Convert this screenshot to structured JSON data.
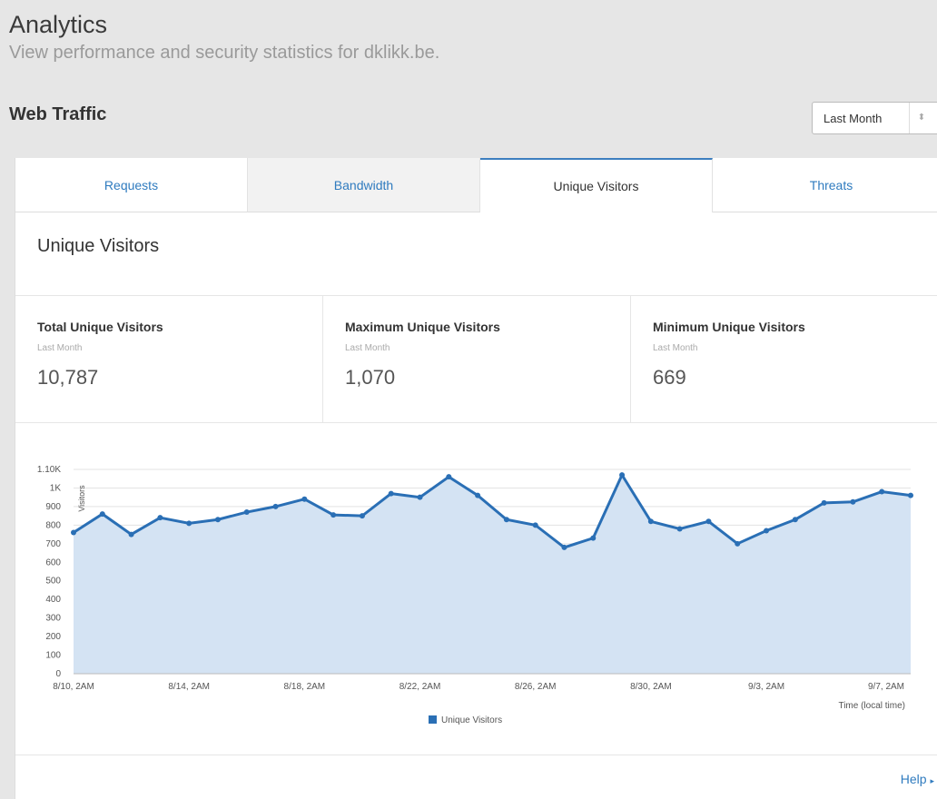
{
  "page": {
    "title": "Analytics",
    "subtitle": "View performance and security statistics for dklikk.be."
  },
  "section": {
    "title": "Web Traffic",
    "period_select": {
      "value": "Last Month",
      "arrows": "⬍"
    }
  },
  "tabs": [
    {
      "label": "Requests"
    },
    {
      "label": "Bandwidth"
    },
    {
      "label": "Unique Visitors"
    },
    {
      "label": "Threats"
    }
  ],
  "panel": {
    "title": "Unique Visitors",
    "stats": [
      {
        "label": "Total Unique Visitors",
        "period": "Last Month",
        "value": "10,787"
      },
      {
        "label": "Maximum Unique Visitors",
        "period": "Last Month",
        "value": "1,070"
      },
      {
        "label": "Minimum Unique Visitors",
        "period": "Last Month",
        "value": "669"
      }
    ],
    "help": {
      "label": "Help",
      "icon": "chevron-right-icon"
    }
  },
  "colors": {
    "accent": "#2f7bbf",
    "series": "#2a6fb5",
    "area": "#d4e3f3"
  },
  "chart_data": {
    "type": "area",
    "ylabel": "Visitors",
    "xlabel": "Time (local time)",
    "ylim": [
      0,
      1100
    ],
    "yticks": [
      "0",
      "100",
      "200",
      "300",
      "400",
      "500",
      "600",
      "700",
      "800",
      "900",
      "1K",
      "1.10K"
    ],
    "xticks": [
      "8/10, 2AM",
      "8/14, 2AM",
      "8/18, 2AM",
      "8/22, 2AM",
      "8/26, 2AM",
      "8/30, 2AM",
      "9/3, 2AM",
      "9/7, 2AM"
    ],
    "grid": true,
    "legend_position": "bottom",
    "series": [
      {
        "name": "Unique Visitors",
        "x": [
          "8/10",
          "8/11",
          "8/12",
          "8/13",
          "8/14",
          "8/15",
          "8/16",
          "8/17",
          "8/18",
          "8/19",
          "8/20",
          "8/21",
          "8/22",
          "8/23",
          "8/24",
          "8/25",
          "8/26",
          "8/27",
          "8/28",
          "8/29",
          "8/30",
          "8/31",
          "9/1",
          "9/2",
          "9/3",
          "9/4",
          "9/5",
          "9/6",
          "9/7",
          "9/8"
        ],
        "values": [
          760,
          860,
          750,
          840,
          810,
          830,
          870,
          900,
          940,
          855,
          850,
          970,
          950,
          1060,
          960,
          830,
          800,
          680,
          730,
          1070,
          820,
          780,
          820,
          700,
          770,
          830,
          920,
          925,
          980,
          960
        ]
      }
    ]
  }
}
